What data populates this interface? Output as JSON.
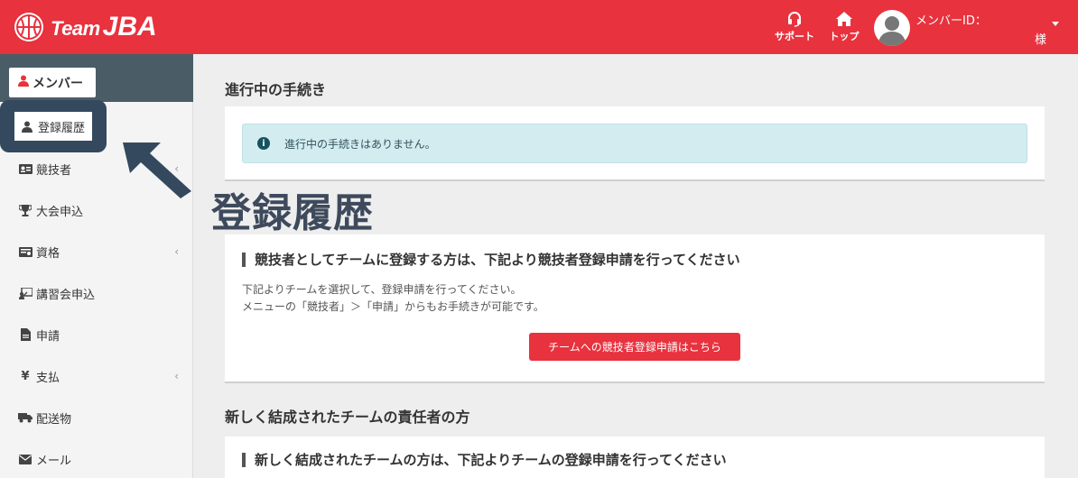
{
  "header": {
    "logo_text_team": "Team",
    "logo_text_jba": "JBA",
    "support_label": "サポート",
    "top_label": "トップ",
    "member_id_label": "メンバーID：",
    "honorific": "様"
  },
  "sidebar": {
    "member_tab": "メンバー",
    "items": [
      {
        "label": "登録履歴",
        "icon": "user-icon"
      },
      {
        "label": "競技者",
        "icon": "id-card-icon",
        "has_submenu": true
      },
      {
        "label": "大会申込",
        "icon": "trophy-icon"
      },
      {
        "label": "資格",
        "icon": "certificate-icon",
        "has_submenu": true
      },
      {
        "label": "講習会申込",
        "icon": "lecture-icon"
      },
      {
        "label": "申請",
        "icon": "file-icon"
      },
      {
        "label": "支払",
        "icon": "yen-icon",
        "has_submenu": true
      },
      {
        "label": "配送物",
        "icon": "truck-icon"
      },
      {
        "label": "メール",
        "icon": "envelope-icon"
      }
    ]
  },
  "main": {
    "section1_title": "進行中の手続き",
    "alert_text": "進行中の手続きはありません。",
    "panel2_heading": "競技者としてチームに登録する方は、下記より競技者登録申請を行ってください",
    "panel2_line1": "下記よりチームを選択して、登録申請を行ってください。",
    "panel2_line2": "メニューの「競技者」＞「申請」からもお手続きが可能です。",
    "panel2_button": "チームへの競技者登録申請はこちら",
    "section2_title": "新しく結成されたチームの責任者の方",
    "panel3_heading": "新しく結成されたチームの方は、下記よりチームの登録申請を行ってください"
  },
  "annotation": {
    "label": "登録履歴"
  },
  "colors": {
    "brand_red": "#e8323e",
    "sidebar_dark": "#4a5d66",
    "annotation": "#34495e",
    "alert_bg": "#d3ecf0"
  }
}
